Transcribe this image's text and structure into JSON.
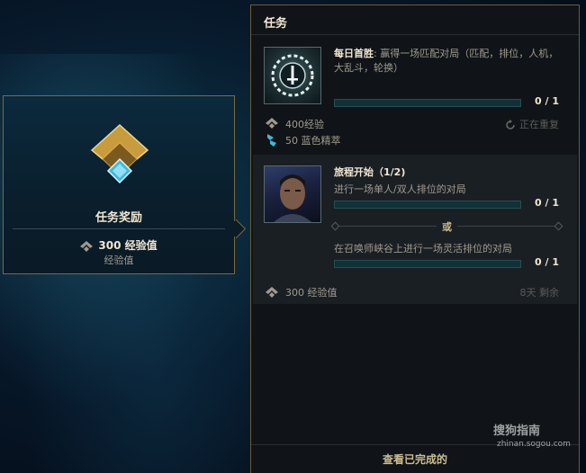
{
  "reward": {
    "title": "任务奖励",
    "xp_value": "300 经验值",
    "xp_label": "经验值"
  },
  "panel": {
    "title": "任务",
    "missions": [
      {
        "title": "每日首胜",
        "description": ": 赢得一场匹配对局（匹配，排位，人机，大乱斗，轮换）",
        "progress": {
          "current": 0,
          "total": 1,
          "label": "0 / 1"
        },
        "rewards": [
          {
            "icon": "xp-icon",
            "text": "400经验"
          },
          {
            "icon": "blue-essence-icon",
            "text": "50 蓝色精萃"
          }
        ],
        "status": "正在重复",
        "status_icon": "repeat-icon"
      },
      {
        "title": "旅程开始（1/2)",
        "objectives": [
          {
            "text": "进行一场单人/双人排位的对局",
            "progress": {
              "current": 0,
              "total": 1,
              "label": "0 / 1"
            }
          },
          {
            "text": "在召唤师峡谷上进行一场灵活排位的对局",
            "progress": {
              "current": 0,
              "total": 1,
              "label": "0 / 1"
            }
          }
        ],
        "separator": "或",
        "rewards": [
          {
            "icon": "xp-icon",
            "text": "300 经验值"
          }
        ],
        "time_left": "8天 剩余"
      }
    ],
    "footer_button": "查看已完成的"
  },
  "watermark": {
    "text": "搜狗指南",
    "sub": "zhinan.sogou.com"
  },
  "colors": {
    "gold": "#cdbe91",
    "border_gold": "#7d6a3a",
    "progress_teal": "#0f3238",
    "bg": "#07182a"
  }
}
